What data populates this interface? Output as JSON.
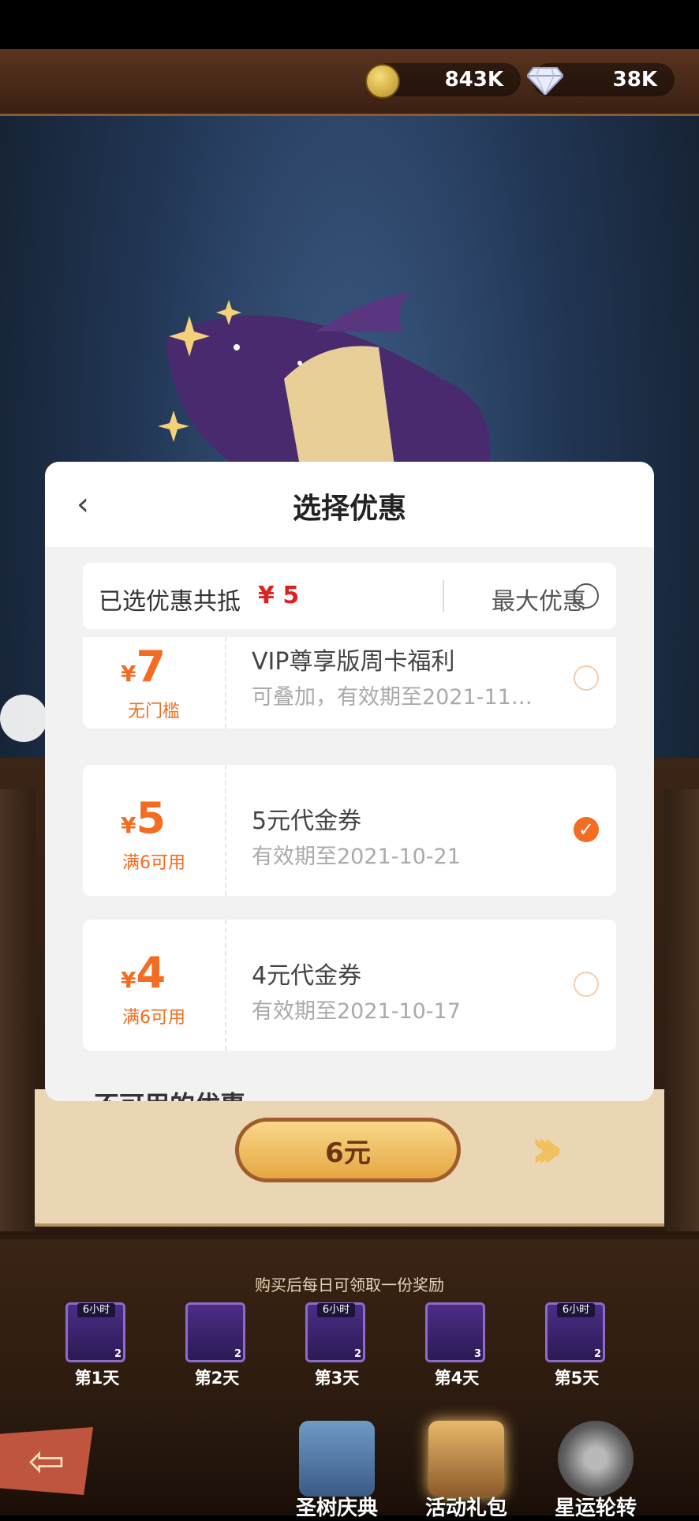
{
  "resources": {
    "coins": "843K",
    "gems": "38K"
  },
  "dialog": {
    "title": "选择优惠",
    "summary": {
      "label": "已选优惠共抵",
      "amount": "¥ 5",
      "max_label": "最大优惠"
    },
    "coupons": [
      {
        "currency": "¥",
        "value": "7",
        "condition": "无门槛",
        "title": "VIP尊享版周卡福利",
        "subtitle": "可叠加，有效期至2021-11…",
        "selected": false
      },
      {
        "currency": "¥",
        "value": "5",
        "condition": "满6可用",
        "title": "5元代金券",
        "subtitle": "有效期至2021-10-21",
        "selected": true
      },
      {
        "currency": "¥",
        "value": "4",
        "condition": "满6可用",
        "title": "4元代金券",
        "subtitle": "有效期至2021-10-17",
        "selected": false
      }
    ],
    "unavailable_header": "不可用的优惠"
  },
  "purchase": {
    "price_label": "6元"
  },
  "rewards": {
    "caption": "购买后每日可领取一份奖励",
    "days": [
      {
        "tag": "6小时",
        "count": "2",
        "day": "第1天"
      },
      {
        "tag": "",
        "count": "2",
        "day": "第2天"
      },
      {
        "tag": "6小时",
        "count": "2",
        "day": "第3天"
      },
      {
        "tag": "",
        "count": "3",
        "day": "第4天"
      },
      {
        "tag": "6小时",
        "count": "2",
        "day": "第5天"
      }
    ]
  },
  "bottom_nav": [
    {
      "label": "圣树庆典",
      "icon": "chest-icon"
    },
    {
      "label": "活动礼包",
      "icon": "gift-bag-icon"
    },
    {
      "label": "星运轮转",
      "icon": "wheel-icon"
    }
  ]
}
